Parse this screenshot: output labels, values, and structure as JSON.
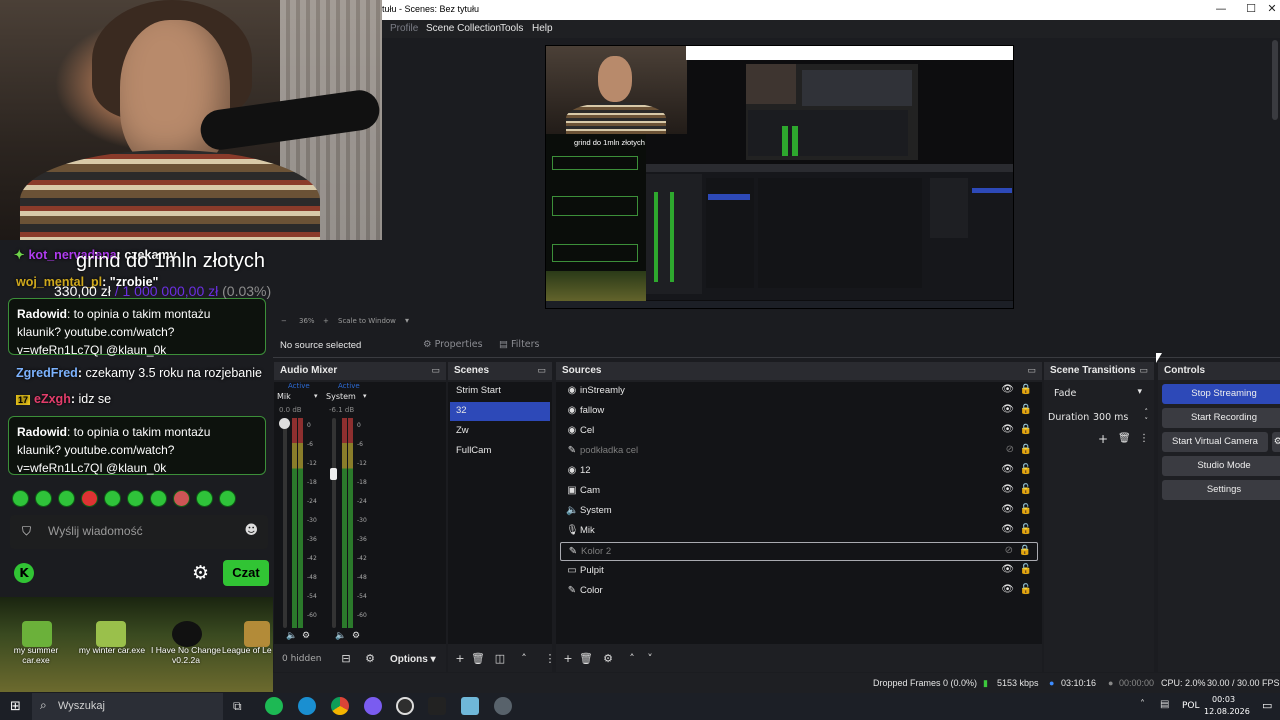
{
  "overlay": {
    "goal_title": "grind do 1mln złotych",
    "goal_amount": "330,00 zł",
    "goal_sep": " / ",
    "goal_target": "1 000 000,00 zł",
    "goal_percent": "(0.03%)"
  },
  "chat": {
    "messages": [
      {
        "user": "kot_nervadena",
        "text": "czekamy",
        "color": "#b03cf0"
      },
      {
        "user": "woj_mental_pl",
        "text": "\"zrobie\"",
        "color": "#cfa81c"
      },
      {
        "user": "Radowid",
        "text": "to opinia o takim montażu klaunik? youtube.com/watch?v=wfeRn1Lc7QI @klaun_0k",
        "color": "#ffffff",
        "boxed": true
      },
      {
        "user": "ZgredFred",
        "text": "czekamy 3.5 roku na rozjebanie",
        "color": "#7db3ff"
      },
      {
        "user": "eZxgh",
        "text": "idz se",
        "color": "#e23d6b",
        "badge": "17"
      },
      {
        "user": "Radowid",
        "text": "to opinia o takim montażu klaunik? youtube.com/watch?v=wfeRn1Lc7QI @klaun_0k",
        "color": "#ffffff",
        "boxed": true
      }
    ],
    "input_placeholder": "Wyślij wiadomość",
    "send_label": "Czat"
  },
  "desktop": {
    "icons": [
      {
        "label": "my summer car.exe",
        "icon": "car-game-icon"
      },
      {
        "label": "my winter car.exe",
        "icon": "car-game-icon"
      },
      {
        "label": "I Have No Change v0.2.2a",
        "icon": "unreal-engine-icon"
      },
      {
        "label": "League of Le",
        "icon": "league-icon"
      }
    ]
  },
  "obs": {
    "title": "tułu - Scenes: Bez tytułu",
    "menu": [
      "Profile",
      "Scene Collection",
      "Tools",
      "Help"
    ],
    "zoom": "36%",
    "scale_label": "Scale to Window",
    "no_source": "No source selected",
    "properties_label": "Properties",
    "filters_label": "Filters",
    "audio_mixer": {
      "title": "Audio Mixer",
      "channels": [
        {
          "name": "Mik",
          "status": "Active",
          "db": "0.0 dB"
        },
        {
          "name": "System",
          "status": "Active",
          "db": "-6.1 dB"
        }
      ],
      "ticks": [
        "0",
        "-6",
        "-12",
        "-18",
        "-24",
        "-30",
        "-36",
        "-42",
        "-48",
        "-54",
        "-60"
      ],
      "hidden": "0 hidden"
    },
    "scenes": {
      "title": "Scenes",
      "items": [
        "Strim Start",
        "32",
        "Zw",
        "FullCam"
      ],
      "selected": 1
    },
    "sources": {
      "title": "Sources",
      "items": [
        {
          "name": "inStreamly",
          "icon": "browser-icon",
          "dim": false
        },
        {
          "name": "fallow",
          "icon": "browser-icon",
          "dim": false
        },
        {
          "name": "Cel",
          "icon": "browser-icon",
          "dim": false
        },
        {
          "name": "podkładka cel",
          "icon": "brush-icon",
          "dim": true
        },
        {
          "name": "12",
          "icon": "browser-icon",
          "dim": false
        },
        {
          "name": "Cam",
          "icon": "camera-icon",
          "dim": false
        },
        {
          "name": "System",
          "icon": "speaker-icon",
          "dim": false
        },
        {
          "name": "Mik",
          "icon": "mic-icon",
          "dim": false
        },
        {
          "name": "Kolor 2",
          "icon": "brush-icon",
          "dim": true
        },
        {
          "name": "Pulpit",
          "icon": "monitor-icon",
          "dim": false
        },
        {
          "name": "Color",
          "icon": "brush-icon",
          "dim": false
        }
      ]
    },
    "options_label": "Options",
    "transitions": {
      "title": "Scene Transitions",
      "selected": "Fade",
      "duration_label": "Duration",
      "duration_value": "300 ms"
    },
    "controls": {
      "title": "Controls",
      "buttons": [
        "Stop Streaming",
        "Start Recording",
        "Start Virtual Camera",
        "Studio Mode",
        "Settings"
      ]
    },
    "status": {
      "dropped": "Dropped Frames 0 (0.0%)",
      "kbps": "5153 kbps",
      "live_time": "03:10:16",
      "rec_time": "00:00:00",
      "cpu": "CPU: 2.0%",
      "fps": "30.00 / 30.00 FPS"
    }
  },
  "taskbar": {
    "search_placeholder": "Wyszukaj",
    "lang": "POL",
    "time": "00:03",
    "date": "12.08.2026"
  },
  "colors": {
    "accent_blue": "#2d49b8",
    "chat_green": "#31c434",
    "dock_bg": "#1e1f23"
  }
}
